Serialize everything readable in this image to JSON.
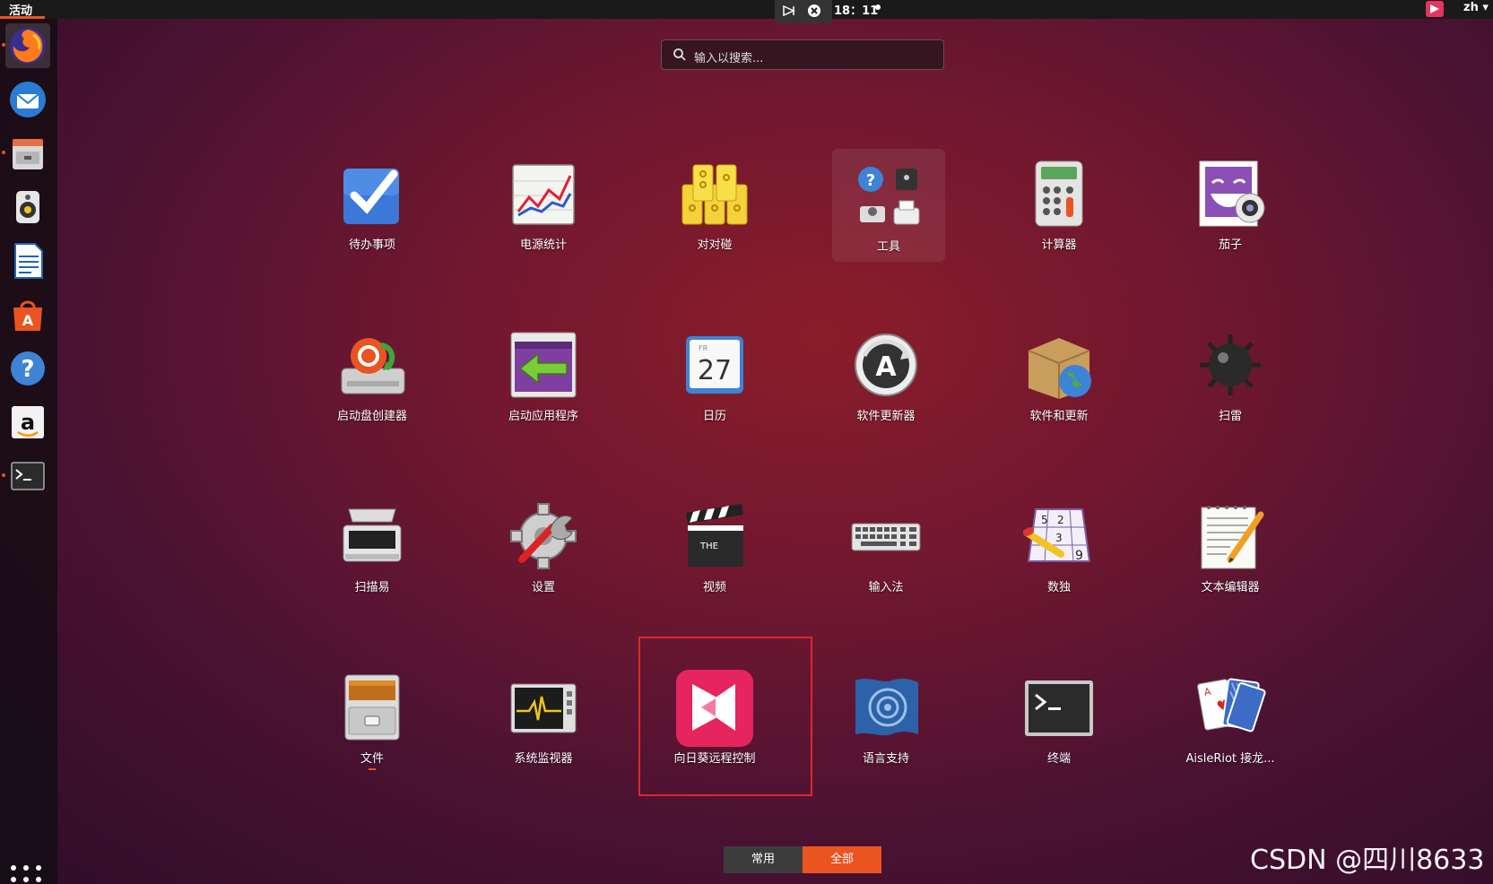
{
  "topbar": {
    "activities": "活动",
    "clock": "18：11",
    "language": "zh"
  },
  "search": {
    "placeholder": "输入以搜索..."
  },
  "apps": [
    {
      "label": "待办事项",
      "icon": "todo-checkbox-icon"
    },
    {
      "label": "电源统计",
      "icon": "power-statistics-icon"
    },
    {
      "label": "对对碰",
      "icon": "mahjongg-tiles-icon"
    },
    {
      "label": "工具",
      "icon": "utilities-folder-icon"
    },
    {
      "label": "计算器",
      "icon": "calculator-icon"
    },
    {
      "label": "茄子",
      "icon": "cheese-webcam-icon"
    },
    {
      "label": "启动盘创建器",
      "icon": "usb-creator-icon"
    },
    {
      "label": "启动应用程序",
      "icon": "startup-applications-icon"
    },
    {
      "label": "日历",
      "icon": "calendar-icon"
    },
    {
      "label": "软件更新器",
      "icon": "software-updater-icon"
    },
    {
      "label": "软件和更新",
      "icon": "software-properties-icon"
    },
    {
      "label": "扫雷",
      "icon": "mines-icon"
    },
    {
      "label": "扫描易",
      "icon": "scanner-icon"
    },
    {
      "label": "设置",
      "icon": "settings-icon"
    },
    {
      "label": "视频",
      "icon": "video-clapperboard-icon"
    },
    {
      "label": "输入法",
      "icon": "keyboard-icon"
    },
    {
      "label": "数独",
      "icon": "sudoku-icon"
    },
    {
      "label": "文本编辑器",
      "icon": "text-editor-icon"
    },
    {
      "label": "文件",
      "icon": "files-cabinet-icon"
    },
    {
      "label": "系统监视器",
      "icon": "system-monitor-icon"
    },
    {
      "label": "向日葵远程控制",
      "icon": "sunlogin-remote-icon"
    },
    {
      "label": "语言支持",
      "icon": "language-support-icon"
    },
    {
      "label": "终端",
      "icon": "terminal-icon"
    },
    {
      "label": "AisleRiot 接龙...",
      "icon": "aisleriot-cards-icon"
    }
  ],
  "calendar_icon": {
    "day_abbr": "FR",
    "day_number": "27"
  },
  "sudoku_icon": {
    "digits": [
      "5",
      "2",
      "3",
      "9"
    ]
  },
  "tabs": {
    "frequent": "常用",
    "all": "全部"
  },
  "watermark": "CSDN @四川8633",
  "colors": {
    "accent": "#e95420",
    "highlight": "#e0262c"
  }
}
